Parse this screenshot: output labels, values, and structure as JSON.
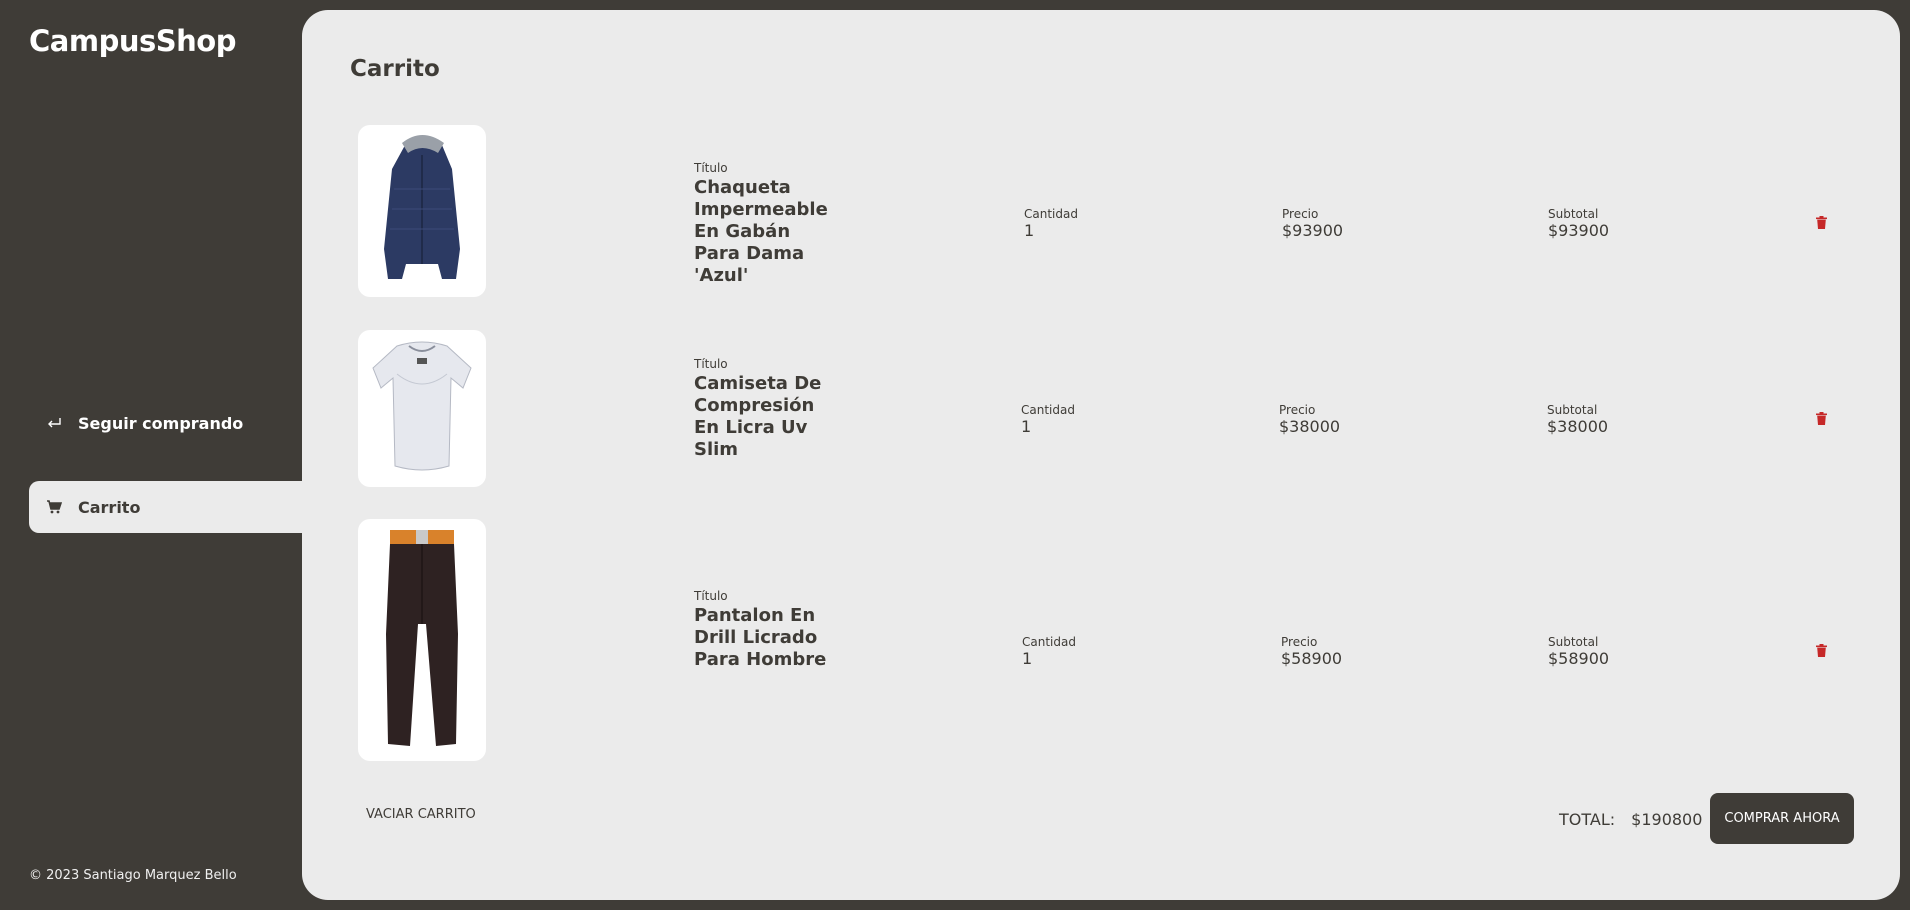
{
  "app": {
    "name": "CampusShop"
  },
  "sidebar": {
    "items": [
      {
        "label": "Seguir comprando",
        "icon": "return-arrow-icon"
      },
      {
        "label": "Carrito",
        "icon": "cart-icon"
      }
    ],
    "footer": "© 2023 Santiago Marquez Bello"
  },
  "cart": {
    "title": "Carrito",
    "labels": {
      "title": "Título",
      "quantity": "Cantidad",
      "price": "Precio",
      "subtotal": "Subtotal"
    },
    "items": [
      {
        "title": "Chaqueta Impermeable En Gabán Para Dama 'Azul'",
        "quantity": "1",
        "price": "$93900",
        "subtotal": "$93900",
        "image": "navy-jacket"
      },
      {
        "title": "Camiseta De Compresión En Licra Uv Slim",
        "quantity": "1",
        "price": "$38000",
        "subtotal": "$38000",
        "image": "white-tshirt"
      },
      {
        "title": "Pantalon En Drill Licrado Para Hombre",
        "quantity": "1",
        "price": "$58900",
        "subtotal": "$58900",
        "image": "brown-pants"
      }
    ],
    "empty_label": "Vaciar carrito",
    "total_label": "TOTAL:",
    "total_value": "$190800",
    "buy_label": "Comprar ahora"
  },
  "colors": {
    "dark": "#3f3c37",
    "panel": "#ebebeb",
    "delete": "#c62828"
  }
}
